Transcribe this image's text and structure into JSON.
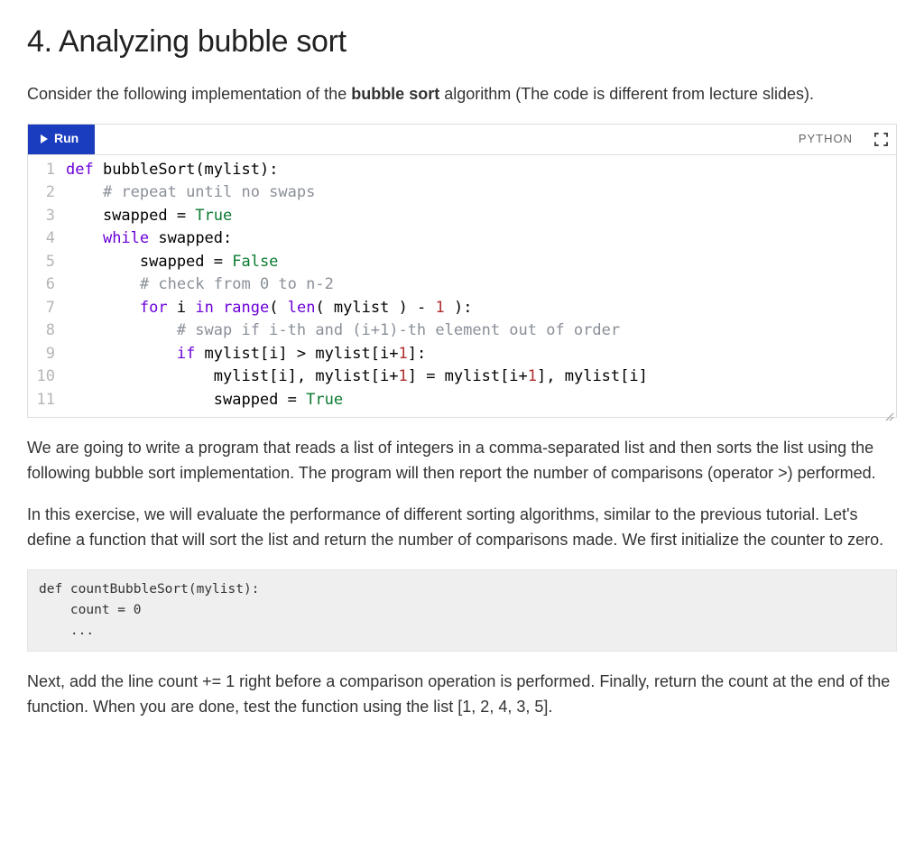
{
  "heading": "4. Analyzing bubble sort",
  "intro_pre": "Consider the following implementation of the ",
  "intro_bold": "bubble sort",
  "intro_post": " algorithm (The code is different from lecture slides).",
  "toolbar": {
    "run_label": "Run",
    "lang_label": "PYTHON"
  },
  "code": {
    "lines": [
      {
        "n": "1",
        "tokens": [
          [
            "kw",
            "def "
          ],
          [
            "fn",
            "bubbleSort"
          ],
          [
            "txt",
            "(mylist):"
          ]
        ]
      },
      {
        "n": "2",
        "tokens": [
          [
            "txt",
            "    "
          ],
          [
            "cmt",
            "# repeat until no swaps"
          ]
        ]
      },
      {
        "n": "3",
        "tokens": [
          [
            "txt",
            "    swapped = "
          ],
          [
            "bool",
            "True"
          ]
        ]
      },
      {
        "n": "4",
        "tokens": [
          [
            "txt",
            "    "
          ],
          [
            "kw",
            "while"
          ],
          [
            "txt",
            " swapped:"
          ]
        ]
      },
      {
        "n": "5",
        "tokens": [
          [
            "txt",
            "        swapped = "
          ],
          [
            "bool",
            "False"
          ]
        ]
      },
      {
        "n": "6",
        "tokens": [
          [
            "txt",
            "        "
          ],
          [
            "cmt",
            "# check from 0 to n-2"
          ]
        ]
      },
      {
        "n": "7",
        "tokens": [
          [
            "txt",
            "        "
          ],
          [
            "kw",
            "for"
          ],
          [
            "txt",
            " i "
          ],
          [
            "kw",
            "in"
          ],
          [
            "txt",
            " "
          ],
          [
            "bi",
            "range"
          ],
          [
            "txt",
            "( "
          ],
          [
            "bi",
            "len"
          ],
          [
            "txt",
            "( mylist ) - "
          ],
          [
            "num",
            "1"
          ],
          [
            "txt",
            " ):"
          ]
        ]
      },
      {
        "n": "8",
        "tokens": [
          [
            "txt",
            "            "
          ],
          [
            "cmt",
            "# swap if i-th and (i+1)-th element out of order"
          ]
        ]
      },
      {
        "n": "9",
        "tokens": [
          [
            "txt",
            "            "
          ],
          [
            "kw",
            "if"
          ],
          [
            "txt",
            " mylist[i] > mylist[i+"
          ],
          [
            "num",
            "1"
          ],
          [
            "txt",
            "]:"
          ]
        ]
      },
      {
        "n": "10",
        "tokens": [
          [
            "txt",
            "                mylist[i], mylist[i+"
          ],
          [
            "num",
            "1"
          ],
          [
            "txt",
            "] = mylist[i+"
          ],
          [
            "num",
            "1"
          ],
          [
            "txt",
            "], mylist[i]"
          ]
        ]
      },
      {
        "n": "11",
        "tokens": [
          [
            "txt",
            "                swapped = "
          ],
          [
            "bool",
            "True"
          ]
        ]
      }
    ]
  },
  "para1": "We are going to write a program that reads a list of integers in a comma-separated list and then sorts the list using the following bubble sort implementation. The program will then report the number of comparisons (operator >) performed.",
  "para2": "In this exercise, we will evaluate the performance of different sorting algorithms, similar to the previous tutorial. Let's define a function that will sort the list and return the number of comparisons made. We first initialize the counter to zero.",
  "snippet": "def countBubbleSort(mylist):\n    count = 0\n    ...",
  "para3": "Next, add the line count += 1 right before a comparison operation is performed. Finally, return the count at the end of the function. When you are done, test the function using the list [1, 2, 4, 3, 5]."
}
